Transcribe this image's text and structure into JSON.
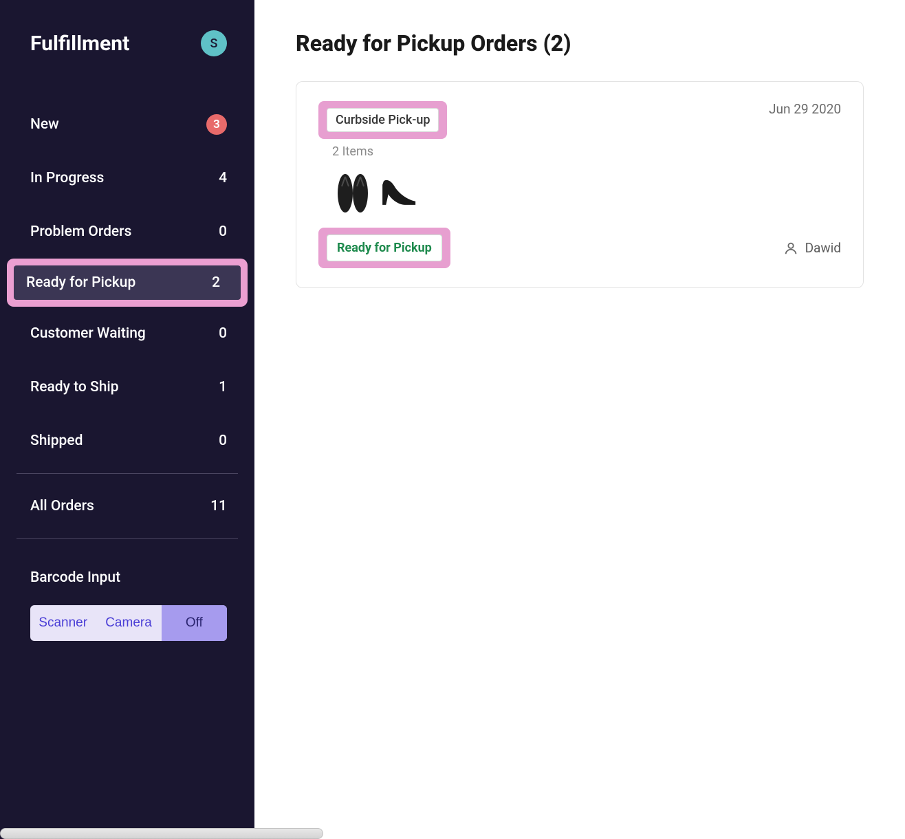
{
  "sidebar": {
    "title": "Fulfillment",
    "avatar_initial": "S",
    "items": [
      {
        "label": "New",
        "count": "3",
        "badge": true
      },
      {
        "label": "In Progress",
        "count": "4"
      },
      {
        "label": "Problem Orders",
        "count": "0"
      },
      {
        "label": "Ready for Pickup",
        "count": "2",
        "active": true
      },
      {
        "label": "Customer Waiting",
        "count": "0"
      },
      {
        "label": "Ready to Ship",
        "count": "1"
      },
      {
        "label": "Shipped",
        "count": "0"
      }
    ],
    "all_orders": {
      "label": "All Orders",
      "count": "11"
    },
    "barcode": {
      "label": "Barcode Input",
      "options": [
        "Scanner",
        "Camera",
        "Off"
      ],
      "active": "Off"
    }
  },
  "main": {
    "title": "Ready for Pickup Orders (2)",
    "order": {
      "date": "Jun 29 2020",
      "pickup_type": "Curbside Pick-up",
      "items_line": "2 Items",
      "product_icons": [
        "flip-flops-icon",
        "high-heel-icon"
      ],
      "status": "Ready for Pickup",
      "assignee": "Dawid"
    }
  },
  "colors": {
    "sidebar_bg": "#1a1630",
    "highlight_pink": "#e79fd0",
    "badge_red": "#e86a6a",
    "avatar_teal": "#5fc1c7",
    "status_green": "#1e8a4d"
  }
}
